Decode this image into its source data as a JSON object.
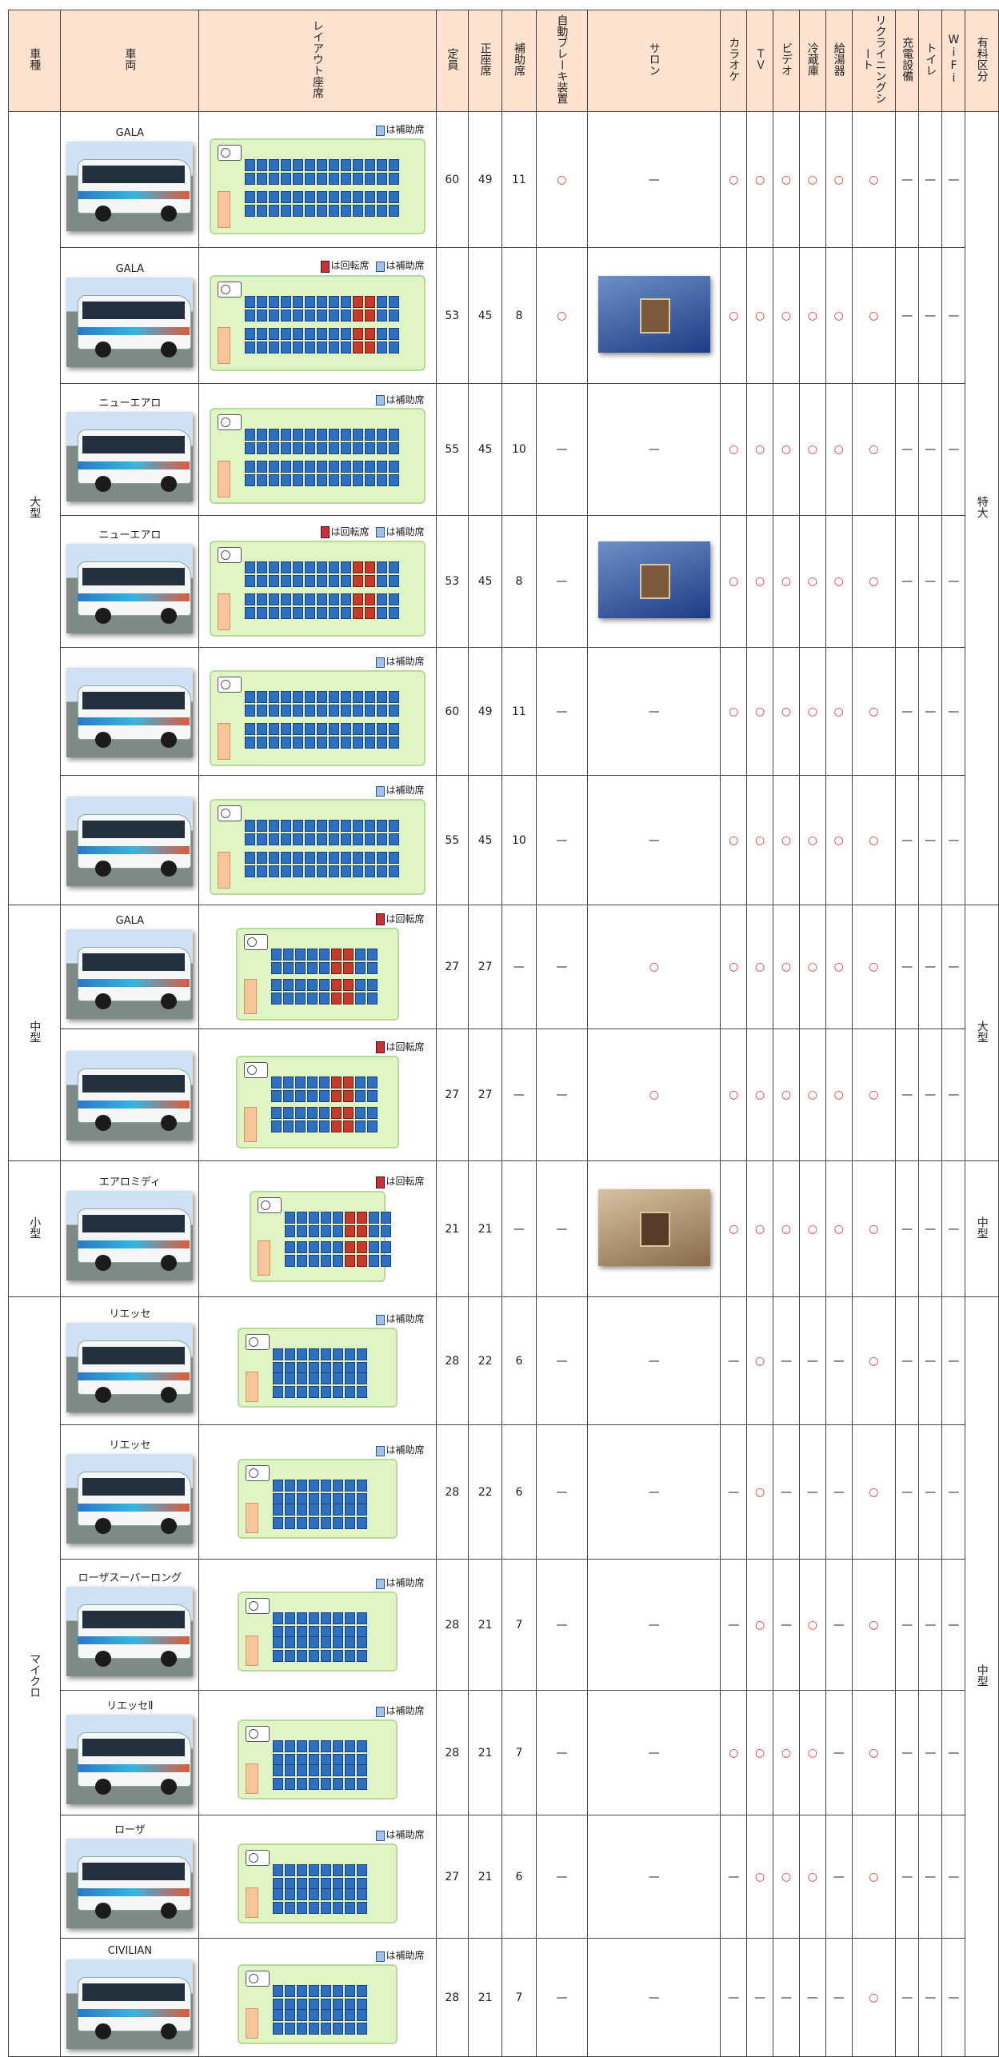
{
  "headers": {
    "category": "車種",
    "vehicle": "車両",
    "layout": "レイアウト座席",
    "capacity": "定員",
    "regular_seats": "正座席",
    "aux_seats": "補助席",
    "auto_brake": "自動ブレーキ装置",
    "salon": "サロン",
    "karaoke": "カラオケ",
    "tv": "ＴＶ",
    "video": "ビデオ",
    "fridge": "冷蔵庫",
    "water_heater": "給湯器",
    "reclining": "リクライニングシート",
    "charging": "充電設備",
    "toilet": "トイレ",
    "wifi": "WiFi",
    "fare_class": "有料区分"
  },
  "legend_labels": {
    "aux": "は補助席",
    "rotating": "は回転席"
  },
  "symbols": {
    "yes": "○",
    "no": "—"
  },
  "groups": [
    {
      "category": "大型",
      "fare_class": "特大",
      "rows": [
        0,
        1,
        2,
        3,
        4,
        5
      ]
    },
    {
      "category": "中型",
      "fare_class": "大型",
      "rows": [
        6,
        7
      ]
    },
    {
      "category": "小型",
      "fare_class": "中型",
      "rows": [
        8
      ]
    },
    {
      "category": "マイクロ",
      "fare_class": "中型",
      "rows": [
        9,
        10,
        11,
        12,
        13,
        14
      ]
    }
  ],
  "rows": [
    {
      "name": "GALA",
      "legend": [
        "aux"
      ],
      "capacity": "60",
      "regular": "49",
      "aux": "11",
      "auto_brake": "○",
      "salon": "—",
      "karaoke": "○",
      "tv": "○",
      "video": "○",
      "fridge": "○",
      "heater": "○",
      "reclining": "○",
      "charging": "—",
      "toilet": "—",
      "wifi": "—"
    },
    {
      "name": "GALA",
      "legend": [
        "rotating",
        "aux"
      ],
      "capacity": "53",
      "regular": "45",
      "aux": "8",
      "auto_brake": "○",
      "salon": "photo",
      "karaoke": "○",
      "tv": "○",
      "video": "○",
      "fridge": "○",
      "heater": "○",
      "reclining": "○",
      "charging": "—",
      "toilet": "—",
      "wifi": "—"
    },
    {
      "name": "ニューエアロ",
      "legend": [
        "aux"
      ],
      "capacity": "55",
      "regular": "45",
      "aux": "10",
      "auto_brake": "—",
      "salon": "—",
      "karaoke": "○",
      "tv": "○",
      "video": "○",
      "fridge": "○",
      "heater": "○",
      "reclining": "○",
      "charging": "—",
      "toilet": "—",
      "wifi": "—"
    },
    {
      "name": "ニューエアロ",
      "legend": [
        "rotating",
        "aux"
      ],
      "capacity": "53",
      "regular": "45",
      "aux": "8",
      "auto_brake": "—",
      "salon": "photo",
      "karaoke": "○",
      "tv": "○",
      "video": "○",
      "fridge": "○",
      "heater": "○",
      "reclining": "○",
      "charging": "—",
      "toilet": "—",
      "wifi": "—"
    },
    {
      "name": "",
      "legend": [
        "aux"
      ],
      "capacity": "60",
      "regular": "49",
      "aux": "11",
      "auto_brake": "—",
      "salon": "—",
      "karaoke": "○",
      "tv": "○",
      "video": "○",
      "fridge": "○",
      "heater": "○",
      "reclining": "○",
      "charging": "—",
      "toilet": "—",
      "wifi": "—"
    },
    {
      "name": "",
      "legend": [
        "aux"
      ],
      "capacity": "55",
      "regular": "45",
      "aux": "10",
      "auto_brake": "—",
      "salon": "—",
      "karaoke": "○",
      "tv": "○",
      "video": "○",
      "fridge": "○",
      "heater": "○",
      "reclining": "○",
      "charging": "—",
      "toilet": "—",
      "wifi": "—"
    },
    {
      "name": "GALA",
      "legend": [
        "rotating"
      ],
      "capacity": "27",
      "regular": "27",
      "aux": "—",
      "auto_brake": "—",
      "salon": "○",
      "karaoke": "○",
      "tv": "○",
      "video": "○",
      "fridge": "○",
      "heater": "○",
      "reclining": "○",
      "charging": "—",
      "toilet": "—",
      "wifi": "—"
    },
    {
      "name": "",
      "legend": [
        "rotating"
      ],
      "capacity": "27",
      "regular": "27",
      "aux": "—",
      "auto_brake": "—",
      "salon": "○",
      "karaoke": "○",
      "tv": "○",
      "video": "○",
      "fridge": "○",
      "heater": "○",
      "reclining": "○",
      "charging": "—",
      "toilet": "—",
      "wifi": "—"
    },
    {
      "name": "エアロミディ",
      "legend": [
        "rotating"
      ],
      "capacity": "21",
      "regular": "21",
      "aux": "—",
      "auto_brake": "—",
      "salon": "photo-beige",
      "karaoke": "○",
      "tv": "○",
      "video": "○",
      "fridge": "○",
      "heater": "○",
      "reclining": "○",
      "charging": "—",
      "toilet": "—",
      "wifi": "—"
    },
    {
      "name": "リエッセ",
      "legend": [
        "aux"
      ],
      "capacity": "28",
      "regular": "22",
      "aux": "6",
      "auto_brake": "—",
      "salon": "—",
      "karaoke": "—",
      "tv": "○",
      "video": "—",
      "fridge": "—",
      "heater": "—",
      "reclining": "○",
      "charging": "—",
      "toilet": "—",
      "wifi": "—"
    },
    {
      "name": "リエッセ",
      "legend": [
        "aux"
      ],
      "capacity": "28",
      "regular": "22",
      "aux": "6",
      "auto_brake": "—",
      "salon": "—",
      "karaoke": "—",
      "tv": "○",
      "video": "—",
      "fridge": "—",
      "heater": "—",
      "reclining": "○",
      "charging": "—",
      "toilet": "—",
      "wifi": "—"
    },
    {
      "name": "ローザスーパーロング",
      "legend": [
        "aux"
      ],
      "capacity": "28",
      "regular": "21",
      "aux": "7",
      "auto_brake": "—",
      "salon": "—",
      "karaoke": "—",
      "tv": "○",
      "video": "—",
      "fridge": "○",
      "heater": "—",
      "reclining": "○",
      "charging": "—",
      "toilet": "—",
      "wifi": "—"
    },
    {
      "name": "リエッセⅡ",
      "legend": [
        "aux"
      ],
      "capacity": "28",
      "regular": "21",
      "aux": "7",
      "auto_brake": "—",
      "salon": "—",
      "karaoke": "○",
      "tv": "○",
      "video": "○",
      "fridge": "○",
      "heater": "—",
      "reclining": "○",
      "charging": "—",
      "toilet": "—",
      "wifi": "—"
    },
    {
      "name": "ローザ",
      "legend": [
        "aux"
      ],
      "capacity": "27",
      "regular": "21",
      "aux": "6",
      "auto_brake": "—",
      "salon": "—",
      "karaoke": "—",
      "tv": "○",
      "video": "○",
      "fridge": "○",
      "heater": "—",
      "reclining": "○",
      "charging": "—",
      "toilet": "—",
      "wifi": "—"
    },
    {
      "name": "CIVILIAN",
      "legend": [
        "aux"
      ],
      "capacity": "28",
      "regular": "21",
      "aux": "7",
      "auto_brake": "—",
      "salon": "—",
      "karaoke": "—",
      "tv": "—",
      "video": "—",
      "fridge": "—",
      "heater": "—",
      "reclining": "○",
      "charging": "—",
      "toilet": "—",
      "wifi": "—"
    }
  ]
}
